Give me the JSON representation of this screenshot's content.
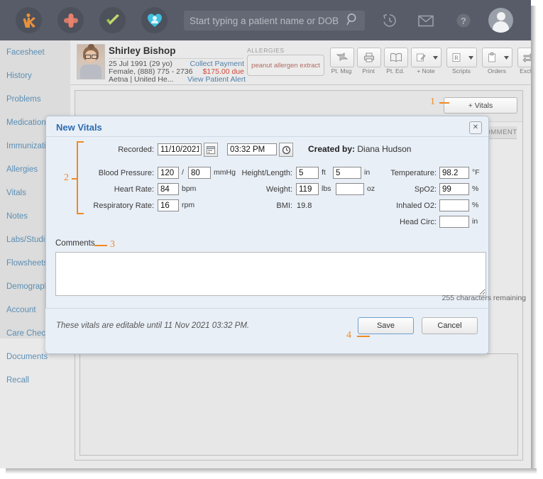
{
  "topbar": {
    "logos": [
      {
        "name": "kareo-k-logo",
        "glyph": "K"
      },
      {
        "name": "bandage-cross-icon",
        "glyph": "+"
      },
      {
        "name": "green-check-icon",
        "glyph": "✓"
      },
      {
        "name": "heart-patient-icon",
        "glyph": "♥"
      }
    ],
    "search_placeholder": "Start typing a patient name or DOB",
    "search_value": "",
    "icons": [
      {
        "name": "history-icon",
        "title": "History"
      },
      {
        "name": "mail-icon",
        "title": "Messages"
      },
      {
        "name": "help-icon",
        "title": "Help"
      },
      {
        "name": "user-avatar",
        "title": "Account"
      }
    ]
  },
  "sidebar": {
    "items": [
      {
        "label": "Facesheet"
      },
      {
        "label": "History"
      },
      {
        "label": "Problems"
      },
      {
        "label": "Medications"
      },
      {
        "label": "Immunizations"
      },
      {
        "label": "Allergies"
      },
      {
        "label": "Vitals"
      },
      {
        "label": "Notes"
      },
      {
        "label": "Labs/Studies"
      },
      {
        "label": "Flowsheets"
      },
      {
        "label": "Demographics"
      },
      {
        "label": "Account"
      },
      {
        "label": "Care Checklist"
      },
      {
        "label": "Documents"
      },
      {
        "label": "Recall"
      }
    ]
  },
  "patient": {
    "name": "Shirley Bishop",
    "dob_line": "25 Jul 1991 (29 yo)",
    "sex_phone_line": "Female, (888) 775 - 2736",
    "insurance_line": "Aetna | United He...",
    "collect_payment": "Collect Payment",
    "amount_due": "$175.00 due",
    "view_patient_alert": "View Patient Alert",
    "allergies_label": "ALLERGIES",
    "allergies_value": "peanut allergen extract"
  },
  "toolbar": [
    {
      "label": "Pt. Msg",
      "icon": "patient-message-icon",
      "caret": false
    },
    {
      "label": "Print",
      "icon": "printer-icon",
      "caret": false
    },
    {
      "label": "Pt. Ed.",
      "icon": "book-icon",
      "caret": false
    },
    {
      "label": "+ Note",
      "icon": "note-pencil-icon",
      "caret": true
    },
    {
      "label": "Scripts",
      "icon": "prescription-icon",
      "caret": true
    },
    {
      "label": "Orders",
      "icon": "clipboard-icon",
      "caret": true
    },
    {
      "label": "Exchange",
      "icon": "exchange-arrows-icon",
      "caret": true
    }
  ],
  "panel": {
    "add_vitals_label": "+ Vitals",
    "comment_column_header": "COMMENT"
  },
  "modal": {
    "title": "New Vitals",
    "close_glyph": "✕",
    "recorded_label": "Recorded:",
    "recorded_date": "11/10/2021",
    "recorded_time": "03:32 PM",
    "calendar_icon": "calendar-icon",
    "clock_icon": "clock-icon",
    "created_by_label": "Created by:",
    "created_by_value": "Diana Hudson",
    "fields": {
      "bp_label": "Blood Pressure:",
      "bp_systolic": "120",
      "bp_separator": "/",
      "bp_diastolic": "80",
      "bp_unit": "mmHg",
      "hr_label": "Heart Rate:",
      "hr_value": "84",
      "hr_unit": "bpm",
      "rr_label": "Respiratory Rate:",
      "rr_value": "16",
      "rr_unit": "rpm",
      "height_label": "Height/Length:",
      "height_ft": "5",
      "height_ft_unit": "ft",
      "height_in": "5",
      "height_in_unit": "in",
      "weight_label": "Weight:",
      "weight_lbs": "119",
      "weight_lbs_unit": "lbs",
      "weight_oz": "",
      "weight_oz_unit": "oz",
      "bmi_label": "BMI:",
      "bmi_value": "19.8",
      "temp_label": "Temperature:",
      "temp_value": "98.2",
      "temp_unit": "°F",
      "spo2_label": "SpO2:",
      "spo2_value": "99",
      "spo2_unit": "%",
      "inhaled_label": "Inhaled O2:",
      "inhaled_value": "",
      "inhaled_unit": "%",
      "headcirc_label": "Head Circ:",
      "headcirc_value": "",
      "headcirc_unit": "in"
    },
    "comments_label": "Comments",
    "comments_value": "",
    "characters_remaining": "255 characters remaining",
    "editable_note": "These vitals are editable until 11 Nov 2021 03:32 PM.",
    "save_label": "Save",
    "cancel_label": "Cancel"
  },
  "annotations": {
    "accent_color": "#ef8b22",
    "markers": [
      {
        "id": "1",
        "target": "add-vitals-button"
      },
      {
        "id": "2",
        "target": "vitals-fields-group"
      },
      {
        "id": "3",
        "target": "comments-section"
      },
      {
        "id": "4",
        "target": "save-button"
      }
    ]
  }
}
